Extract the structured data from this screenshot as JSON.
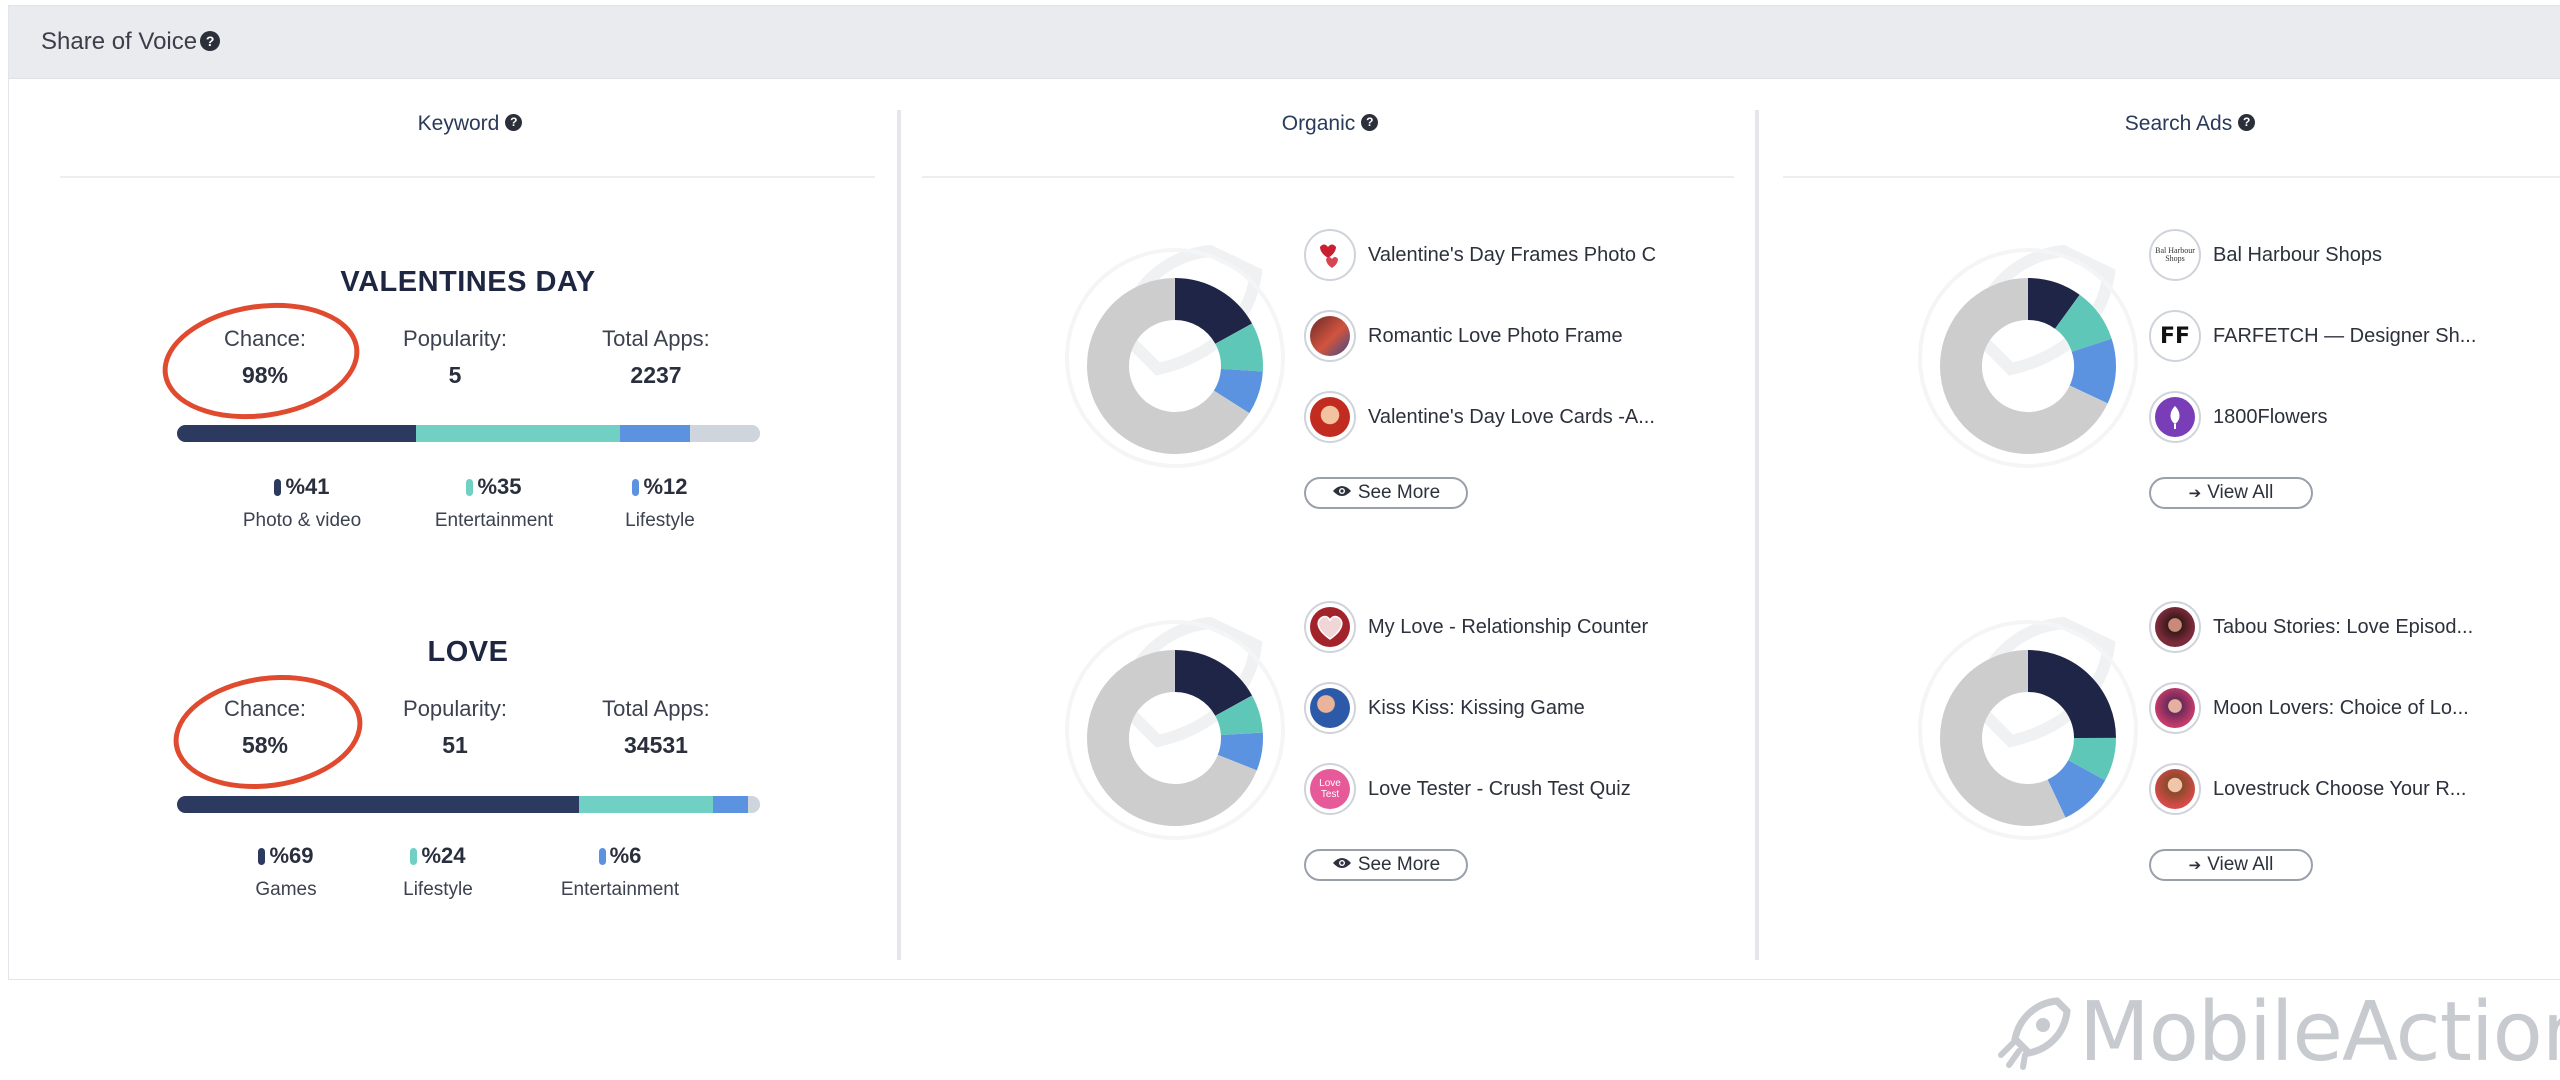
{
  "header": {
    "title": "Share of Voice",
    "help_icon": "question-circle-icon"
  },
  "columns": {
    "keyword": {
      "title": "Keyword"
    },
    "organic": {
      "title": "Organic"
    },
    "search_ads": {
      "title": "Search Ads"
    }
  },
  "keywords": [
    {
      "name": "VALENTINES DAY",
      "chance_label": "Chance:",
      "chance": "98%",
      "popularity_label": "Popularity:",
      "popularity": "5",
      "total_apps_label": "Total Apps:",
      "total_apps": "2237",
      "bar_fractions": [
        0.41,
        0.35,
        0.12,
        0.12
      ],
      "categories": [
        {
          "pct": "%41",
          "name": "Photo & video",
          "color": "#2b3a5e"
        },
        {
          "pct": "%35",
          "name": "Entertainment",
          "color": "#6fd0c3"
        },
        {
          "pct": "%12",
          "name": "Lifestyle",
          "color": "#5b93e0"
        }
      ]
    },
    {
      "name": "LOVE",
      "chance_label": "Chance:",
      "chance": "58%",
      "popularity_label": "Popularity:",
      "popularity": "51",
      "total_apps_label": "Total Apps:",
      "total_apps": "34531",
      "bar_fractions": [
        0.69,
        0.23,
        0.06,
        0.02
      ],
      "categories": [
        {
          "pct": "%69",
          "name": "Games",
          "color": "#2b3a5e"
        },
        {
          "pct": "%24",
          "name": "Lifestyle",
          "color": "#6fd0c3"
        },
        {
          "pct": "%6",
          "name": "Entertainment",
          "color": "#5b93e0"
        }
      ]
    }
  ],
  "organic": [
    {
      "donut": [
        0.17,
        0.09,
        0.08,
        0.66
      ],
      "apps": [
        "Valentine's Day Frames Photo C",
        "Romantic Love Photo Frame",
        "Valentine's Day Love Cards -A..."
      ],
      "button": "See More"
    },
    {
      "donut": [
        0.17,
        0.07,
        0.07,
        0.69
      ],
      "apps": [
        "My Love - Relationship Counter",
        "Kiss Kiss: Kissing Game",
        "Love Tester - Crush Test Quiz"
      ],
      "button": "See More"
    }
  ],
  "search_ads": [
    {
      "donut": [
        0.1,
        0.1,
        0.12,
        0.68
      ],
      "apps": [
        "Bal Harbour Shops",
        "FARFETCH — Designer Sh...",
        "1800Flowers"
      ],
      "button": "View All"
    },
    {
      "donut": [
        0.25,
        0.08,
        0.1,
        0.57
      ],
      "apps": [
        "Tabou Stories: Love Episod...",
        "Moon Lovers: Choice of Lo...",
        "Lovestruck Choose Your R..."
      ],
      "button": "View All"
    }
  ],
  "app_icon_text": {
    "bal_harbour": "Bal Harbour Shops",
    "farfetch": "FF",
    "love_tester": "Love Test"
  },
  "colors": {
    "navy": "#1f2547",
    "teal": "#5fc7b8",
    "blue": "#5b93e0",
    "gray": "#cdcdcd",
    "highlight": "#e04a2f"
  },
  "watermark": {
    "text": "MobileAction"
  }
}
